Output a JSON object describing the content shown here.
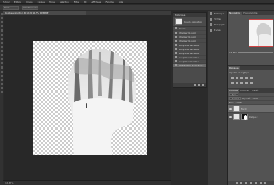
{
  "menu": [
    "Fichier",
    "Édition",
    "Image",
    "Calque",
    "Texte",
    "Sélection",
    "Filtre",
    "3D",
    "Affichage",
    "Fenêtre",
    "Aide"
  ],
  "options": {
    "mode_label": "Lisse",
    "refine_label": "Améliorer le contour"
  },
  "document": {
    "tab_title": "double exposition 40 pt @ 16,7% (RVB/8#)"
  },
  "status": {
    "zoom": "16,67%"
  },
  "history": {
    "title": "Historique",
    "snapshot_label": "Double exposition",
    "items": [
      "Ouvrir",
      "Changer de nom",
      "Changer de nom",
      "Changer de nom",
      "Supprimer le calque",
      "Supprimer le calque",
      "Supprimer le calque",
      "Supprimer le calque",
      "Supprimer le calque",
      "Modification de la forme"
    ]
  },
  "iconic_panels": [
    {
      "label": "Historique",
      "icon": "history-icon"
    },
    {
      "label": "Formes",
      "icon": "shapes-icon"
    },
    {
      "label": "Paragraphe",
      "icon": "paragraph-icon"
    },
    {
      "label": "Tracés",
      "icon": "paths-icon"
    }
  ],
  "navigator": {
    "tabs": [
      "Navigation",
      "Histogramme"
    ],
    "zoom": "16,67%"
  },
  "adjustments": {
    "tab": "Réglages",
    "title": "Ajouter un réglage"
  },
  "layers": {
    "tabs": [
      "Calques",
      "Couches",
      "Tracés"
    ],
    "kind_label": "Type",
    "blend_mode": "Normal",
    "opacity_label": "Opacité : 100%",
    "fill_label": "Fond : 100%",
    "items": [
      {
        "name": "Forêt",
        "selected": true
      },
      {
        "name": "Calque 1",
        "selected": false
      }
    ]
  }
}
